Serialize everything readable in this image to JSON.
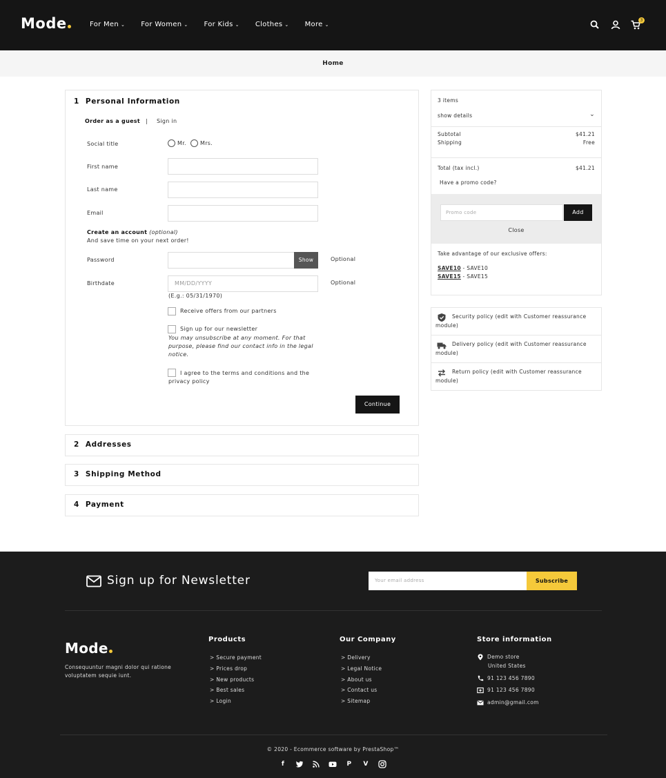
{
  "header": {
    "logo": "Mode",
    "nav": [
      {
        "label": "For Men"
      },
      {
        "label": "For Women"
      },
      {
        "label": "For Kids"
      },
      {
        "label": "Clothes"
      },
      {
        "label": "More"
      }
    ],
    "cart_count": "3"
  },
  "breadcrumb": "Home",
  "checkout": {
    "step1": {
      "number": "1",
      "title": "Personal Information",
      "guest_tab": "Order as a guest",
      "separator": "|",
      "signin_tab": "Sign in",
      "social_title_label": "Social title",
      "mr": "Mr.",
      "mrs": "Mrs.",
      "first_name_label": "First name",
      "last_name_label": "Last name",
      "email_label": "Email",
      "create_account": "Create an account",
      "optional_italic": "(optional)",
      "save_time": "And save time on your next order!",
      "password_label": "Password",
      "show_label": "Show",
      "optional": "Optional",
      "birthdate_label": "Birthdate",
      "birthdate_placeholder": "MM/DD/YYYY",
      "birthdate_hint": "(E.g.: 05/31/1970)",
      "offers_label": "Receive offers from our partners",
      "newsletter_label": "Sign up for our newsletter",
      "newsletter_note": "You may unsubscribe at any moment. For that purpose, please find our contact info in the legal notice.",
      "terms_label": "I agree to the terms and conditions and the privacy policy",
      "continue_label": "Continue"
    },
    "step2": {
      "number": "2",
      "title": "Addresses"
    },
    "step3": {
      "number": "3",
      "title": "Shipping Method"
    },
    "step4": {
      "number": "4",
      "title": "Payment"
    }
  },
  "summary": {
    "items": "3 items",
    "show_details": "show details",
    "subtotal_label": "Subtotal",
    "subtotal_value": "$41.21",
    "shipping_label": "Shipping",
    "shipping_value": "Free",
    "total_label": "Total (tax incl.)",
    "total_value": "$41.21",
    "promo_question": "Have a promo code?",
    "promo_placeholder": "Promo code",
    "add_label": "Add",
    "close_label": "Close",
    "offers_text": "Take advantage of our exclusive offers:",
    "codes": [
      {
        "code": "SAVE10",
        "label": " - SAVE10"
      },
      {
        "code": "SAVE15",
        "label": " - SAVE15"
      }
    ]
  },
  "reassurance": [
    {
      "icon": "shield-icon",
      "text": "Security policy (edit with Customer reassurance module)"
    },
    {
      "icon": "truck-icon",
      "text": "Delivery policy (edit with Customer reassurance module)"
    },
    {
      "icon": "swap-arrows-icon",
      "text": "Return policy (edit with Customer reassurance module)"
    }
  ],
  "footer": {
    "newsletter_title": "Sign up for Newsletter",
    "email_placeholder": "Your email address",
    "subscribe_label": "Subscribe",
    "logo": "Mode",
    "description": "Consequuntur magni dolor qui ratione voluptatem sequie iunt.",
    "products_title": "Products",
    "products": [
      "> Secure payment",
      "> Prices drop",
      "> New products",
      "> Best sales",
      "> Login"
    ],
    "company_title": "Our Company",
    "company": [
      "> Delivery",
      "> Legal Notice",
      "> About us",
      "> Contact us",
      "> Sitemap"
    ],
    "store_title": "Store information",
    "store_line1": "Demo store",
    "store_line2": "United States",
    "phone": "91 123 456 7890",
    "fax": "91 123 456 7890",
    "email": "admin@gmail.com",
    "copyright": "© 2020 - Ecommerce software by PrestaShop™"
  },
  "colors": {
    "dark": "#151515",
    "accent": "#f5c93a",
    "footer": "#1c1c1c"
  }
}
